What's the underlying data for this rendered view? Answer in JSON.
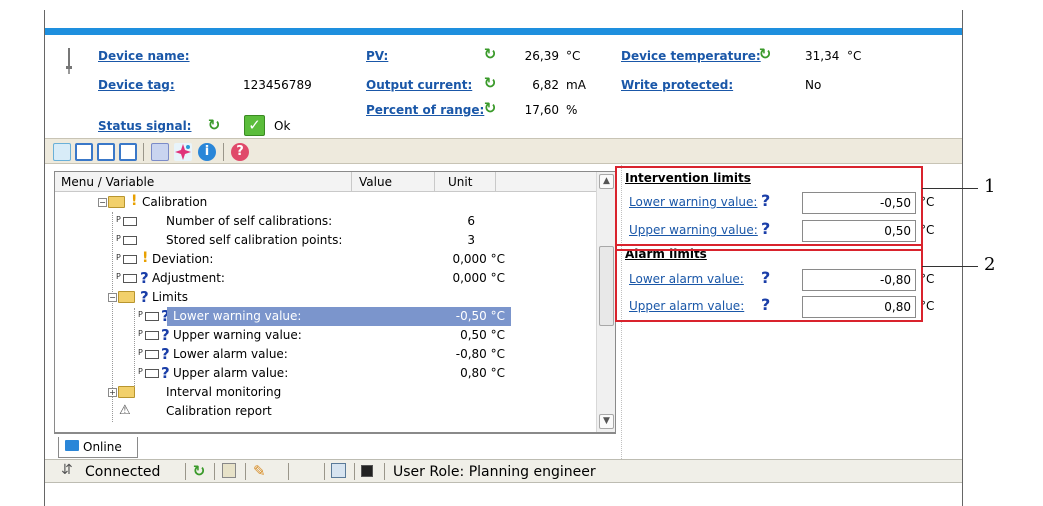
{
  "header": {
    "device_name_label": "Device name:",
    "device_tag_label": "Device tag:",
    "device_tag_value": "123456789",
    "status_signal_label": "Status signal:",
    "status_signal_value": "Ok",
    "pv_label": "PV:",
    "pv_value": "26,39",
    "pv_unit": "°C",
    "output_current_label": "Output current:",
    "output_current_value": "6,82",
    "output_current_unit": "mA",
    "percent_range_label": "Percent of range:",
    "percent_range_value": "17,60",
    "percent_range_unit": "%",
    "device_temp_label": "Device temperature:",
    "device_temp_value": "31,34",
    "device_temp_unit": "°C",
    "write_protected_label": "Write protected:",
    "write_protected_value": "No"
  },
  "tree": {
    "columns": [
      "Menu / Variable",
      "Value",
      "Unit"
    ],
    "rows": [
      {
        "label": "Calibration",
        "value": ""
      },
      {
        "label": "Number of self calibrations:",
        "value": "6"
      },
      {
        "label": "Stored self calibration points:",
        "value": "3"
      },
      {
        "label": "Deviation:",
        "value": "0,000 °C"
      },
      {
        "label": "Adjustment:",
        "value": "0,000 °C"
      },
      {
        "label": "Limits",
        "value": ""
      },
      {
        "label": "Lower warning value:",
        "value": "-0,50 °C"
      },
      {
        "label": "Upper warning value:",
        "value": "0,50 °C"
      },
      {
        "label": "Lower alarm value:",
        "value": "-0,80 °C"
      },
      {
        "label": "Upper alarm value:",
        "value": "0,80 °C"
      },
      {
        "label": "Interval monitoring",
        "value": ""
      },
      {
        "label": "Calibration report",
        "value": ""
      }
    ]
  },
  "tabs": {
    "online": "Online"
  },
  "status": {
    "connected": "Connected",
    "user_role": "User Role: Planning engineer"
  },
  "panel": {
    "intervention_title": "Intervention limits",
    "lower_warning_label": "Lower warning value:",
    "lower_warning_value": "-0,50",
    "upper_warning_label": "Upper warning value:",
    "upper_warning_value": "0,50",
    "alarm_title": "Alarm limits",
    "lower_alarm_label": "Lower alarm value:",
    "lower_alarm_value": "-0,80",
    "upper_alarm_label": "Upper alarm value:",
    "upper_alarm_value": "0,80",
    "unit": "°C",
    "question_mark": "?"
  },
  "callouts": [
    "1",
    "2"
  ],
  "colors": {
    "accent": "#1e8fde",
    "link": "#1a57a8",
    "callout_box": "#d9232d",
    "selection": "#7b95cc"
  },
  "icons": [
    "gauge-icon",
    "refresh-icon",
    "ok-check-icon",
    "help-icon",
    "info-icon",
    "folder-icon",
    "parameter-icon",
    "connected-icon"
  ]
}
